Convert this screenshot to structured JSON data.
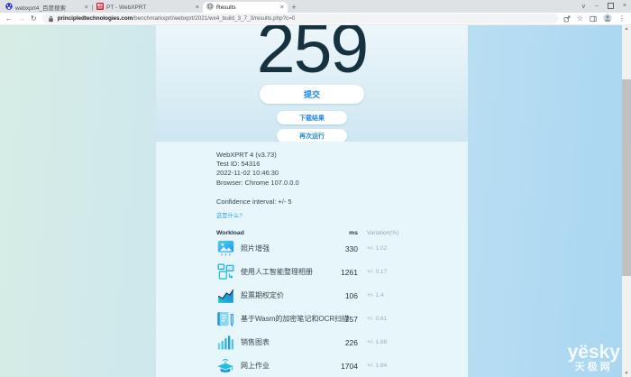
{
  "browser": {
    "tabs": [
      {
        "title": "webxprt4_百度搜索",
        "icon": "baidu-paw",
        "active": false
      },
      {
        "title": "PT - WebXPRT",
        "icon": "pt-logo",
        "active": false
      },
      {
        "title": "Results",
        "icon": "globe",
        "active": true
      }
    ],
    "new_tab_label": "+",
    "url_domain": "principledtechnologies.com",
    "url_path": "/benchmarkxprt/webxprt/2021/wx4_build_3_7_3/results.php?c=0",
    "toolbar_icons": [
      "back",
      "forward",
      "reload",
      "lock",
      "share",
      "bookmark-star",
      "side-panel",
      "profile-avatar",
      "menu-kebab"
    ],
    "window_controls": [
      "tab-search",
      "minimize",
      "maximize",
      "close"
    ]
  },
  "result": {
    "score": "259",
    "submit_label": "提交",
    "download_label": "下载结果",
    "rerun_label": "再次运行"
  },
  "details": {
    "app_version": "WebXPRT 4 (v3.73)",
    "test_id": "Test ID: 54316",
    "datetime": "2022-11-02 10:46:30",
    "browser_line": "Browser: Chrome 107.0.0.0",
    "confidence": "Confidence interval: +/- 5",
    "what_link": "这是什么?"
  },
  "table": {
    "headers": {
      "workload": "Workload",
      "ms": "ms",
      "variation": "Variation(%)"
    },
    "rows": [
      {
        "icon": "photo-enhance",
        "label": "照片增强",
        "ms": "330",
        "variation": "+/- 1.02"
      },
      {
        "icon": "ai-album",
        "label": "使用人工智能整理相册",
        "ms": "1261",
        "variation": "+/- 0.17"
      },
      {
        "icon": "stock-options",
        "label": "股票期权定价",
        "ms": "106",
        "variation": "+/- 1.4"
      },
      {
        "icon": "wasm-notes",
        "label": "基于Wasm的加密笔记和OCR扫描",
        "ms": "757",
        "variation": "+/- 0.61"
      },
      {
        "icon": "sales-chart",
        "label": "销售图表",
        "ms": "226",
        "variation": "+/- 1.68"
      },
      {
        "icon": "online-homework",
        "label": "网上作业",
        "ms": "1704",
        "variation": "+/- 1.84"
      }
    ]
  },
  "watermark": {
    "logo": "yësky",
    "sub": "天极网"
  },
  "colors": {
    "accent_blue": "#1e88e5",
    "score_text": "#17323f",
    "link_blue": "#2fa4e0",
    "hero_top": "#edf6fa",
    "hero_bottom": "#cde7f2",
    "info_bg": "#e7f6fb",
    "page_gradient_left": "#d7ece5",
    "page_gradient_right": "#a9d6f2"
  }
}
